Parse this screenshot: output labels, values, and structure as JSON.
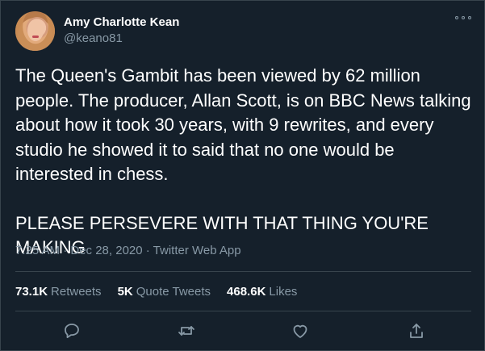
{
  "tweet": {
    "author_name": "Amy Charlotte Kean",
    "author_handle": "@keano81",
    "paragraph_1": "The Queen's Gambit has been viewed by 62 million people. The producer, Allan Scott, is on BBC News talking about how it took 30 years, with 9 rewrites, and every studio he showed it to said that no one would be interested in chess.",
    "paragraph_2": "PLEASE PERSEVERE WITH THAT THING YOU'RE MAKING",
    "timestamp": "7:25 AM · Dec 28, 2020 · Twitter Web App"
  },
  "stats": {
    "retweets_count": "73.1K",
    "retweets_label": "Retweets",
    "quotes_count": "5K",
    "quotes_label": "Quote Tweets",
    "likes_count": "468.6K",
    "likes_label": "Likes"
  },
  "icons": {
    "more": "more-icon",
    "reply": "reply-icon",
    "retweet": "retweet-icon",
    "like": "heart-icon",
    "share": "share-icon"
  },
  "colors": {
    "background": "#15202b",
    "text": "#ffffff",
    "secondary_text": "#8899a6",
    "divider": "#38444d"
  }
}
